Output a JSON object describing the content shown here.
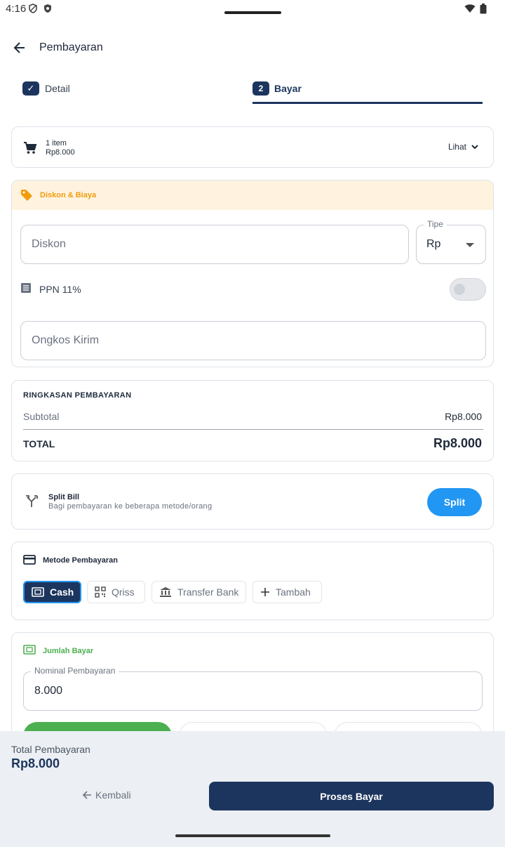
{
  "status": {
    "time": "4:16"
  },
  "header": {
    "title": "Pembayaran"
  },
  "stepper": {
    "step1_label": "Detail",
    "step1_mark": "✓",
    "step2_number": "2",
    "step2_label": "Bayar"
  },
  "cart": {
    "count": "1 item",
    "price": "Rp8.000",
    "view_label": "Lihat"
  },
  "discount": {
    "title": "Diskon & Biaya",
    "diskon_placeholder": "Diskon",
    "type_label": "Tipe",
    "type_value": "Rp",
    "ppn_label": "PPN 11%",
    "ppn_enabled": false,
    "ongkos_placeholder": "Ongkos Kirim"
  },
  "summary": {
    "title": "RINGKASAN PEMBAYARAN",
    "subtotal_label": "Subtotal",
    "subtotal_value": "Rp8.000",
    "total_label": "TOTAL",
    "total_value": "Rp8.000"
  },
  "split": {
    "title": "Split Bill",
    "description": "Bagi pembayaran ke beberapa metode/orang",
    "button_label": "Split"
  },
  "payment_methods": {
    "title": "Metode Pembayaran",
    "selected": "Cash",
    "options": [
      {
        "label": "Cash",
        "icon": "cash-icon"
      },
      {
        "label": "Qriss",
        "icon": "qr-code-icon"
      },
      {
        "label": "Transfer Bank",
        "icon": "bank-icon"
      },
      {
        "label": "Tambah",
        "icon": "plus-icon"
      }
    ]
  },
  "amount": {
    "title": "Jumlah Bayar",
    "field_label": "Nominal Pembayaran",
    "field_value": "8.000"
  },
  "footer": {
    "total_label": "Total Pembayaran",
    "total_value": "Rp8.000",
    "back_label": "Kembali",
    "process_label": "Proses Bayar"
  },
  "colors": {
    "primary": "#1c355e",
    "accent_blue": "#2196f3",
    "success_green": "#4caf50",
    "discount_orange": "#f29b0a",
    "discount_bg": "#fff3e0"
  }
}
